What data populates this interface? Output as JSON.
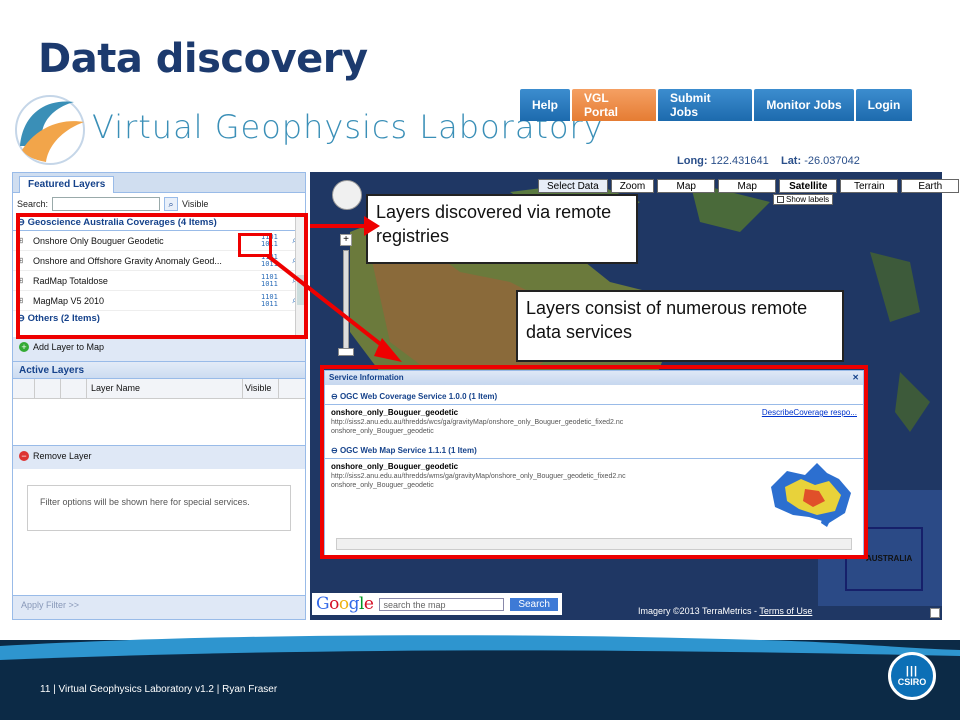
{
  "slide": {
    "title": "Data discovery"
  },
  "app": {
    "logo_text": "Virtual Geophysics Laboratory"
  },
  "nav": {
    "items": [
      "Help",
      "VGL Portal",
      "Submit Jobs",
      "Monitor Jobs",
      "Login"
    ],
    "active": "VGL Portal"
  },
  "coords": {
    "long_label": "Long:",
    "long_value": "122.431641",
    "lat_label": "Lat:",
    "lat_value": "-26.037042"
  },
  "featured": {
    "tab": "Featured Layers",
    "search_label": "Search:",
    "visible_label": "Visible",
    "group1": "Geoscience Australia Coverages (4 Items)",
    "layers": [
      "Onshore Only Bouguer Geodetic",
      "Onshore and Offshore Gravity Anomaly Geod...",
      "RadMap Totaldose",
      "MagMap V5 2010"
    ],
    "group2": "Others (2 Items)",
    "add_button": "Add Layer to Map"
  },
  "active_layers": {
    "title": "Active Layers",
    "col_name": "Layer Name",
    "col_visible": "Visible",
    "remove_button": "Remove Layer"
  },
  "filter": {
    "text": "Filter options will be shown here for special services.",
    "apply": "Apply Filter >>"
  },
  "map_toolbar": {
    "buttons": [
      "Select Data",
      "Zoom",
      "Map",
      "Map",
      "Satellite",
      "Terrain",
      "Earth"
    ],
    "show_labels": "Show labels"
  },
  "callouts": {
    "registries": "Layers discovered via remote registries",
    "services": "Layers consist of numerous remote data services"
  },
  "service_info": {
    "title": "Service Information",
    "group1": "OGC Web Coverage Service 1.0.0 (1 Item)",
    "item1_name": "onshore_only_Bouguer_geodetic",
    "item1_url": "http://siss2.anu.edu.au/thredds/wcs/ga/gravityMap/onshore_only_Bouguer_geodetic_fixed2.nc",
    "item1_layer": "onshore_only_Bouguer_geodetic",
    "item1_link": "DescribeCoverage respo...",
    "group2": "OGC Web Map Service 1.1.1 (1 Item)",
    "item2_name": "onshore_only_Bouguer_geodetic",
    "item2_url": "http://siss2.anu.edu.au/thredds/wms/ga/gravityMap/onshore_only_Bouguer_geodetic_fixed2.nc",
    "item2_layer": "onshore_only_Bouguer_geodetic"
  },
  "google": {
    "logo": "Google",
    "placeholder": "search the map",
    "button": "Search"
  },
  "imagery": {
    "text": "Imagery ©2013 TerraMetrics - ",
    "terms": "Terms of Use"
  },
  "overview_label": "AUSTRALIA",
  "footer": {
    "text": "11  |  Virtual Geophysics Laboratory v1.2 | Ryan Fraser",
    "brand": "CSIRO"
  },
  "colors": {
    "brand_navy": "#1c3a6e",
    "nav_blue": "#1d6aad",
    "nav_active": "#e57c33",
    "highlight_red": "#e00000"
  }
}
